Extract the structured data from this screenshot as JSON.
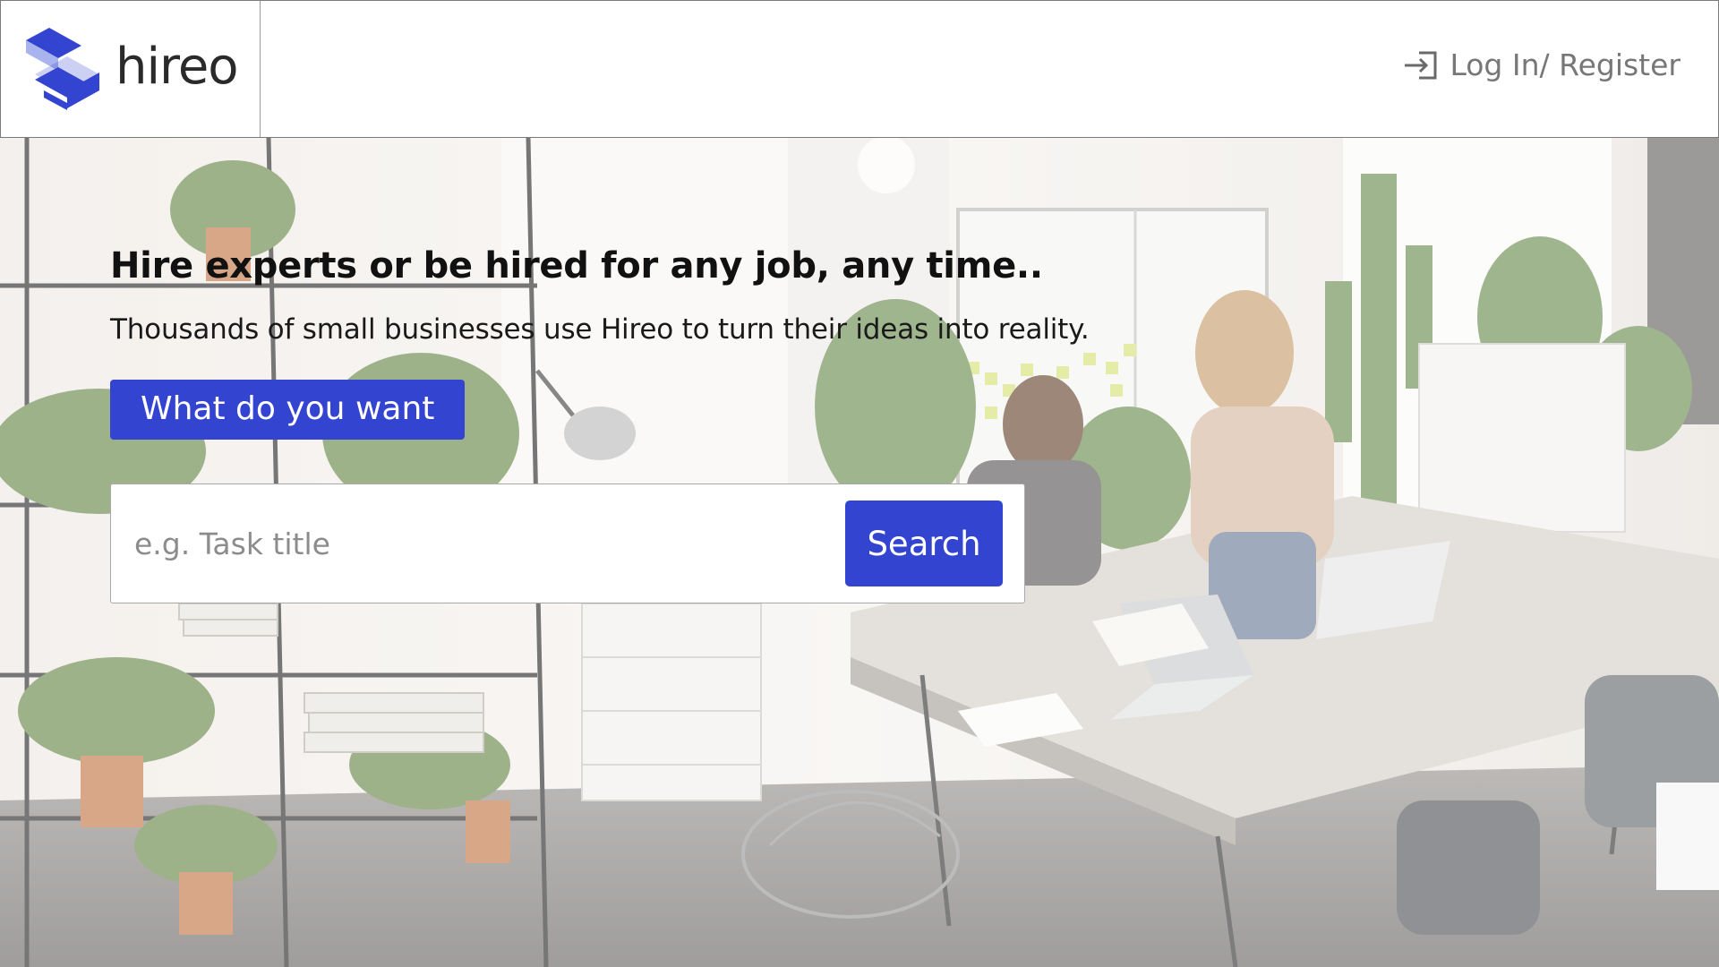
{
  "brand": {
    "name": "hireo",
    "accent_color": "#3344d0",
    "logo_icon": "hireo-logo-icon"
  },
  "header": {
    "login_label": "Log In/ Register",
    "login_icon": "login-arrow-icon"
  },
  "hero": {
    "headline": "Hire experts or be hired for any job, any time..",
    "subline": "Thousands of small businesses use Hireo to turn their ideas into reality.",
    "want_button_label": "What do you want",
    "background_image": "office-workspace-photo"
  },
  "search": {
    "placeholder": "e.g. Task title",
    "value": "",
    "button_label": "Search"
  }
}
